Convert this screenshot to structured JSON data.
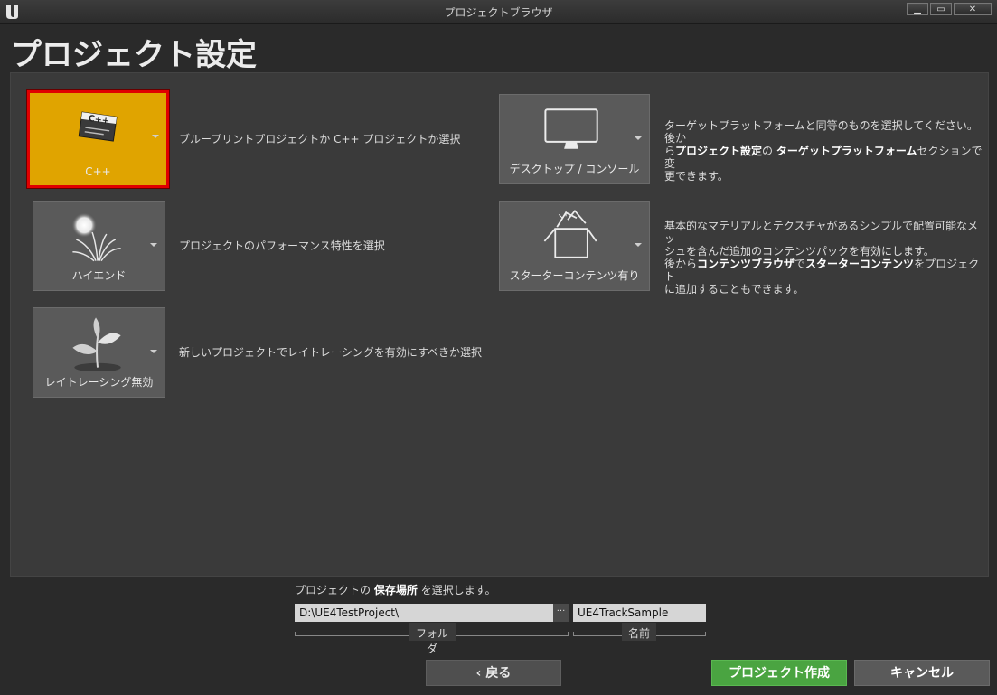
{
  "window": {
    "title": "プロジェクトブラウザ",
    "min": "▁",
    "max": "▭",
    "close": "✕"
  },
  "page_title": "プロジェクト設定",
  "options": {
    "cpp": {
      "label": "C++",
      "icon_text": "C++",
      "desc": "ブループリントプロジェクトか C++ プロジェクトか選択"
    },
    "quality": {
      "label": "ハイエンド",
      "desc": "プロジェクトのパフォーマンス特性を選択"
    },
    "raytracing": {
      "label": "レイトレーシング無効",
      "desc": "新しいプロジェクトでレイトレーシングを有効にすべきか選択"
    },
    "platform": {
      "label": "デスクトップ / コンソール",
      "desc_1": "ターゲットプラットフォームと同等のものを選択してください。後か",
      "desc_2a": "ら",
      "desc_2b": "プロジェクト設定",
      "desc_2c": "の ",
      "desc_2d": "ターゲットプラットフォーム",
      "desc_2e": "セクションで変",
      "desc_3": "更できます。"
    },
    "starter": {
      "label": "スターターコンテンツ有り",
      "desc_1": "基本的なマテリアルとテクスチャがあるシンプルで配置可能なメッ",
      "desc_2": "シュを含んだ追加のコンテンツパックを有効にします。",
      "desc_3a": "後から",
      "desc_3b": "コンテンツブラウザ",
      "desc_3c": "で",
      "desc_3d": "スターターコンテンツ",
      "desc_3e": "をプロジェクト",
      "desc_4": "に追加することもできます。"
    }
  },
  "location": {
    "label_a": "プロジェクトの ",
    "label_b": "保存場所",
    "label_c": " を選択します。",
    "folder_value": "D:\\UE4TestProject\\",
    "browse": "···",
    "folder_tag": "フォルダ",
    "name_value": "UE4TrackSample",
    "name_tag": "名前"
  },
  "buttons": {
    "back": "‹ 戻る",
    "create": "プロジェクト作成",
    "cancel": "キャンセル"
  },
  "colors": {
    "selected_tile": "#e0a400",
    "selected_border": "#e00000",
    "create_button": "#4aa441"
  }
}
